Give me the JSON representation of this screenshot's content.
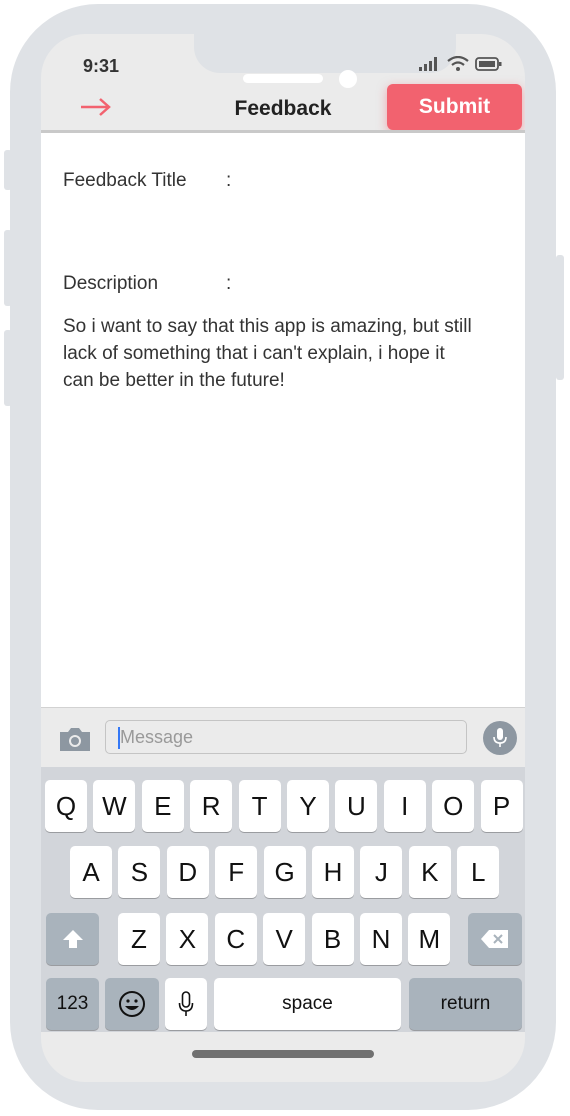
{
  "status_bar": {
    "time": "9:31"
  },
  "nav": {
    "title": "Feedback",
    "back_icon": "arrow-right-icon",
    "submit_label": "Submit",
    "accent_color": "#f2626f"
  },
  "form": {
    "title_label": "Feedback Title",
    "title_colon": ":",
    "description_label": "Description",
    "description_colon": ":",
    "description_text": "So i want to say that this app is amazing, but still lack of something that i can't explain, i hope it can be better in the future!"
  },
  "message_bar": {
    "placeholder": "Message",
    "camera_icon": "camera-icon",
    "mic_icon": "microphone-icon"
  },
  "keyboard": {
    "row1": [
      "Q",
      "W",
      "E",
      "R",
      "T",
      "Y",
      "U",
      "I",
      "O",
      "P"
    ],
    "row2": [
      "A",
      "S",
      "D",
      "F",
      "G",
      "H",
      "J",
      "K",
      "L"
    ],
    "row3": [
      "Z",
      "X",
      "C",
      "V",
      "B",
      "N",
      "M"
    ],
    "numbers_label": "123",
    "space_label": "space",
    "return_label": "return",
    "shift_icon": "shift-icon",
    "delete_icon": "delete-icon",
    "emoji_icon": "emoji-icon",
    "dictation_icon": "microphone-icon"
  }
}
